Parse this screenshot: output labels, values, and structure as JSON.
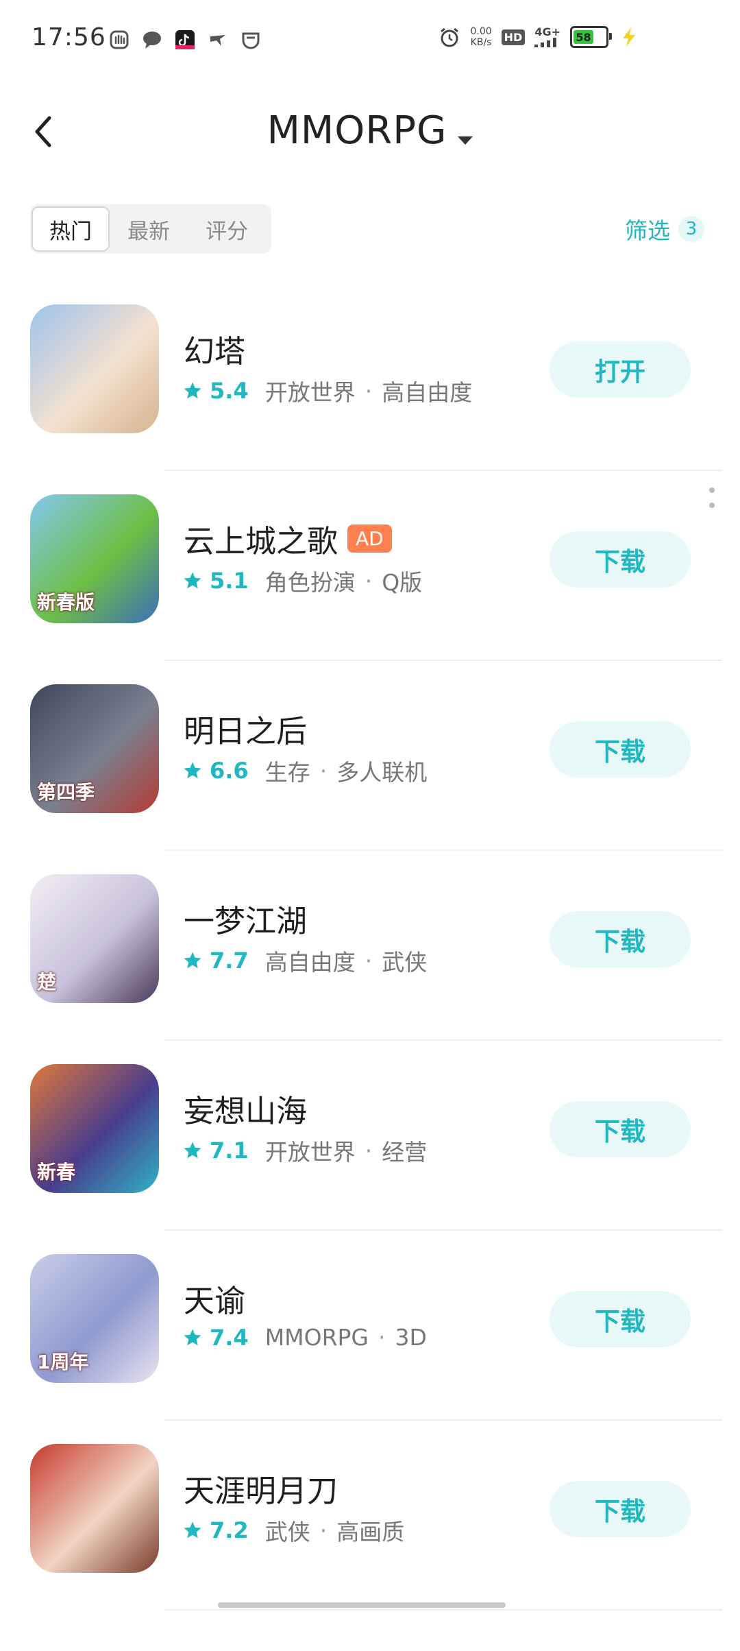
{
  "status_bar": {
    "time": "17:56",
    "net_speed_value": "0.00",
    "net_speed_unit": "KB/s",
    "hd_label": "HD",
    "network_label": "4G+",
    "battery_level": "58",
    "left_icons": [
      "hand-icon",
      "message-icon",
      "tiktok-icon",
      "drone-icon",
      "app-icon"
    ]
  },
  "header": {
    "title": "MMORPG"
  },
  "sort_tabs": [
    {
      "label": "热门",
      "active": true
    },
    {
      "label": "最新",
      "active": false
    },
    {
      "label": "评分",
      "active": false
    }
  ],
  "filter": {
    "label": "筛选",
    "count": "3"
  },
  "apps": [
    {
      "name": "幻塔",
      "rating": "5.4",
      "tags": [
        "开放世界",
        "高自由度"
      ],
      "button": "打开",
      "ad": "",
      "icon_overlay": "",
      "icon_colors": [
        "#9cc3ec",
        "#f3e1cf",
        "#d5b48f"
      ]
    },
    {
      "name": "云上城之歌",
      "rating": "5.1",
      "tags": [
        "角色扮演",
        "Q版"
      ],
      "button": "下载",
      "ad": "AD",
      "icon_overlay": "新春版",
      "icon_colors": [
        "#83c7ef",
        "#6dbf45",
        "#3d6fb8"
      ]
    },
    {
      "name": "明日之后",
      "rating": "6.6",
      "tags": [
        "生存",
        "多人联机"
      ],
      "button": "下载",
      "ad": "",
      "icon_overlay": "第四季",
      "icon_colors": [
        "#3d4659",
        "#7a8090",
        "#b53a32"
      ]
    },
    {
      "name": "一梦江湖",
      "rating": "7.7",
      "tags": [
        "高自由度",
        "武侠"
      ],
      "button": "下载",
      "ad": "",
      "icon_overlay": "楚",
      "icon_colors": [
        "#f2eef3",
        "#c9c2dc",
        "#4b3b5c"
      ]
    },
    {
      "name": "妄想山海",
      "rating": "7.1",
      "tags": [
        "开放世界",
        "经营"
      ],
      "button": "下载",
      "ad": "",
      "icon_overlay": "新春",
      "icon_colors": [
        "#e0783b",
        "#4a3d8c",
        "#2fb3c6"
      ]
    },
    {
      "name": "天谕",
      "rating": "7.4",
      "tags": [
        "MMORPG",
        "3D"
      ],
      "button": "下载",
      "ad": "",
      "icon_overlay": "1周年",
      "icon_colors": [
        "#c8cde8",
        "#8f9ad0",
        "#e9e3ef"
      ]
    },
    {
      "name": "天涯明月刀",
      "rating": "7.2",
      "tags": [
        "武侠",
        "高画质"
      ],
      "button": "下载",
      "ad": "",
      "icon_overlay": "",
      "icon_colors": [
        "#c43a2c",
        "#f2d4c3",
        "#7b3b2a"
      ]
    }
  ],
  "theme": {
    "accent": "#1fb8c1",
    "button_bg": "#e8f8f8",
    "ad_bg": "#ff7f4f"
  }
}
